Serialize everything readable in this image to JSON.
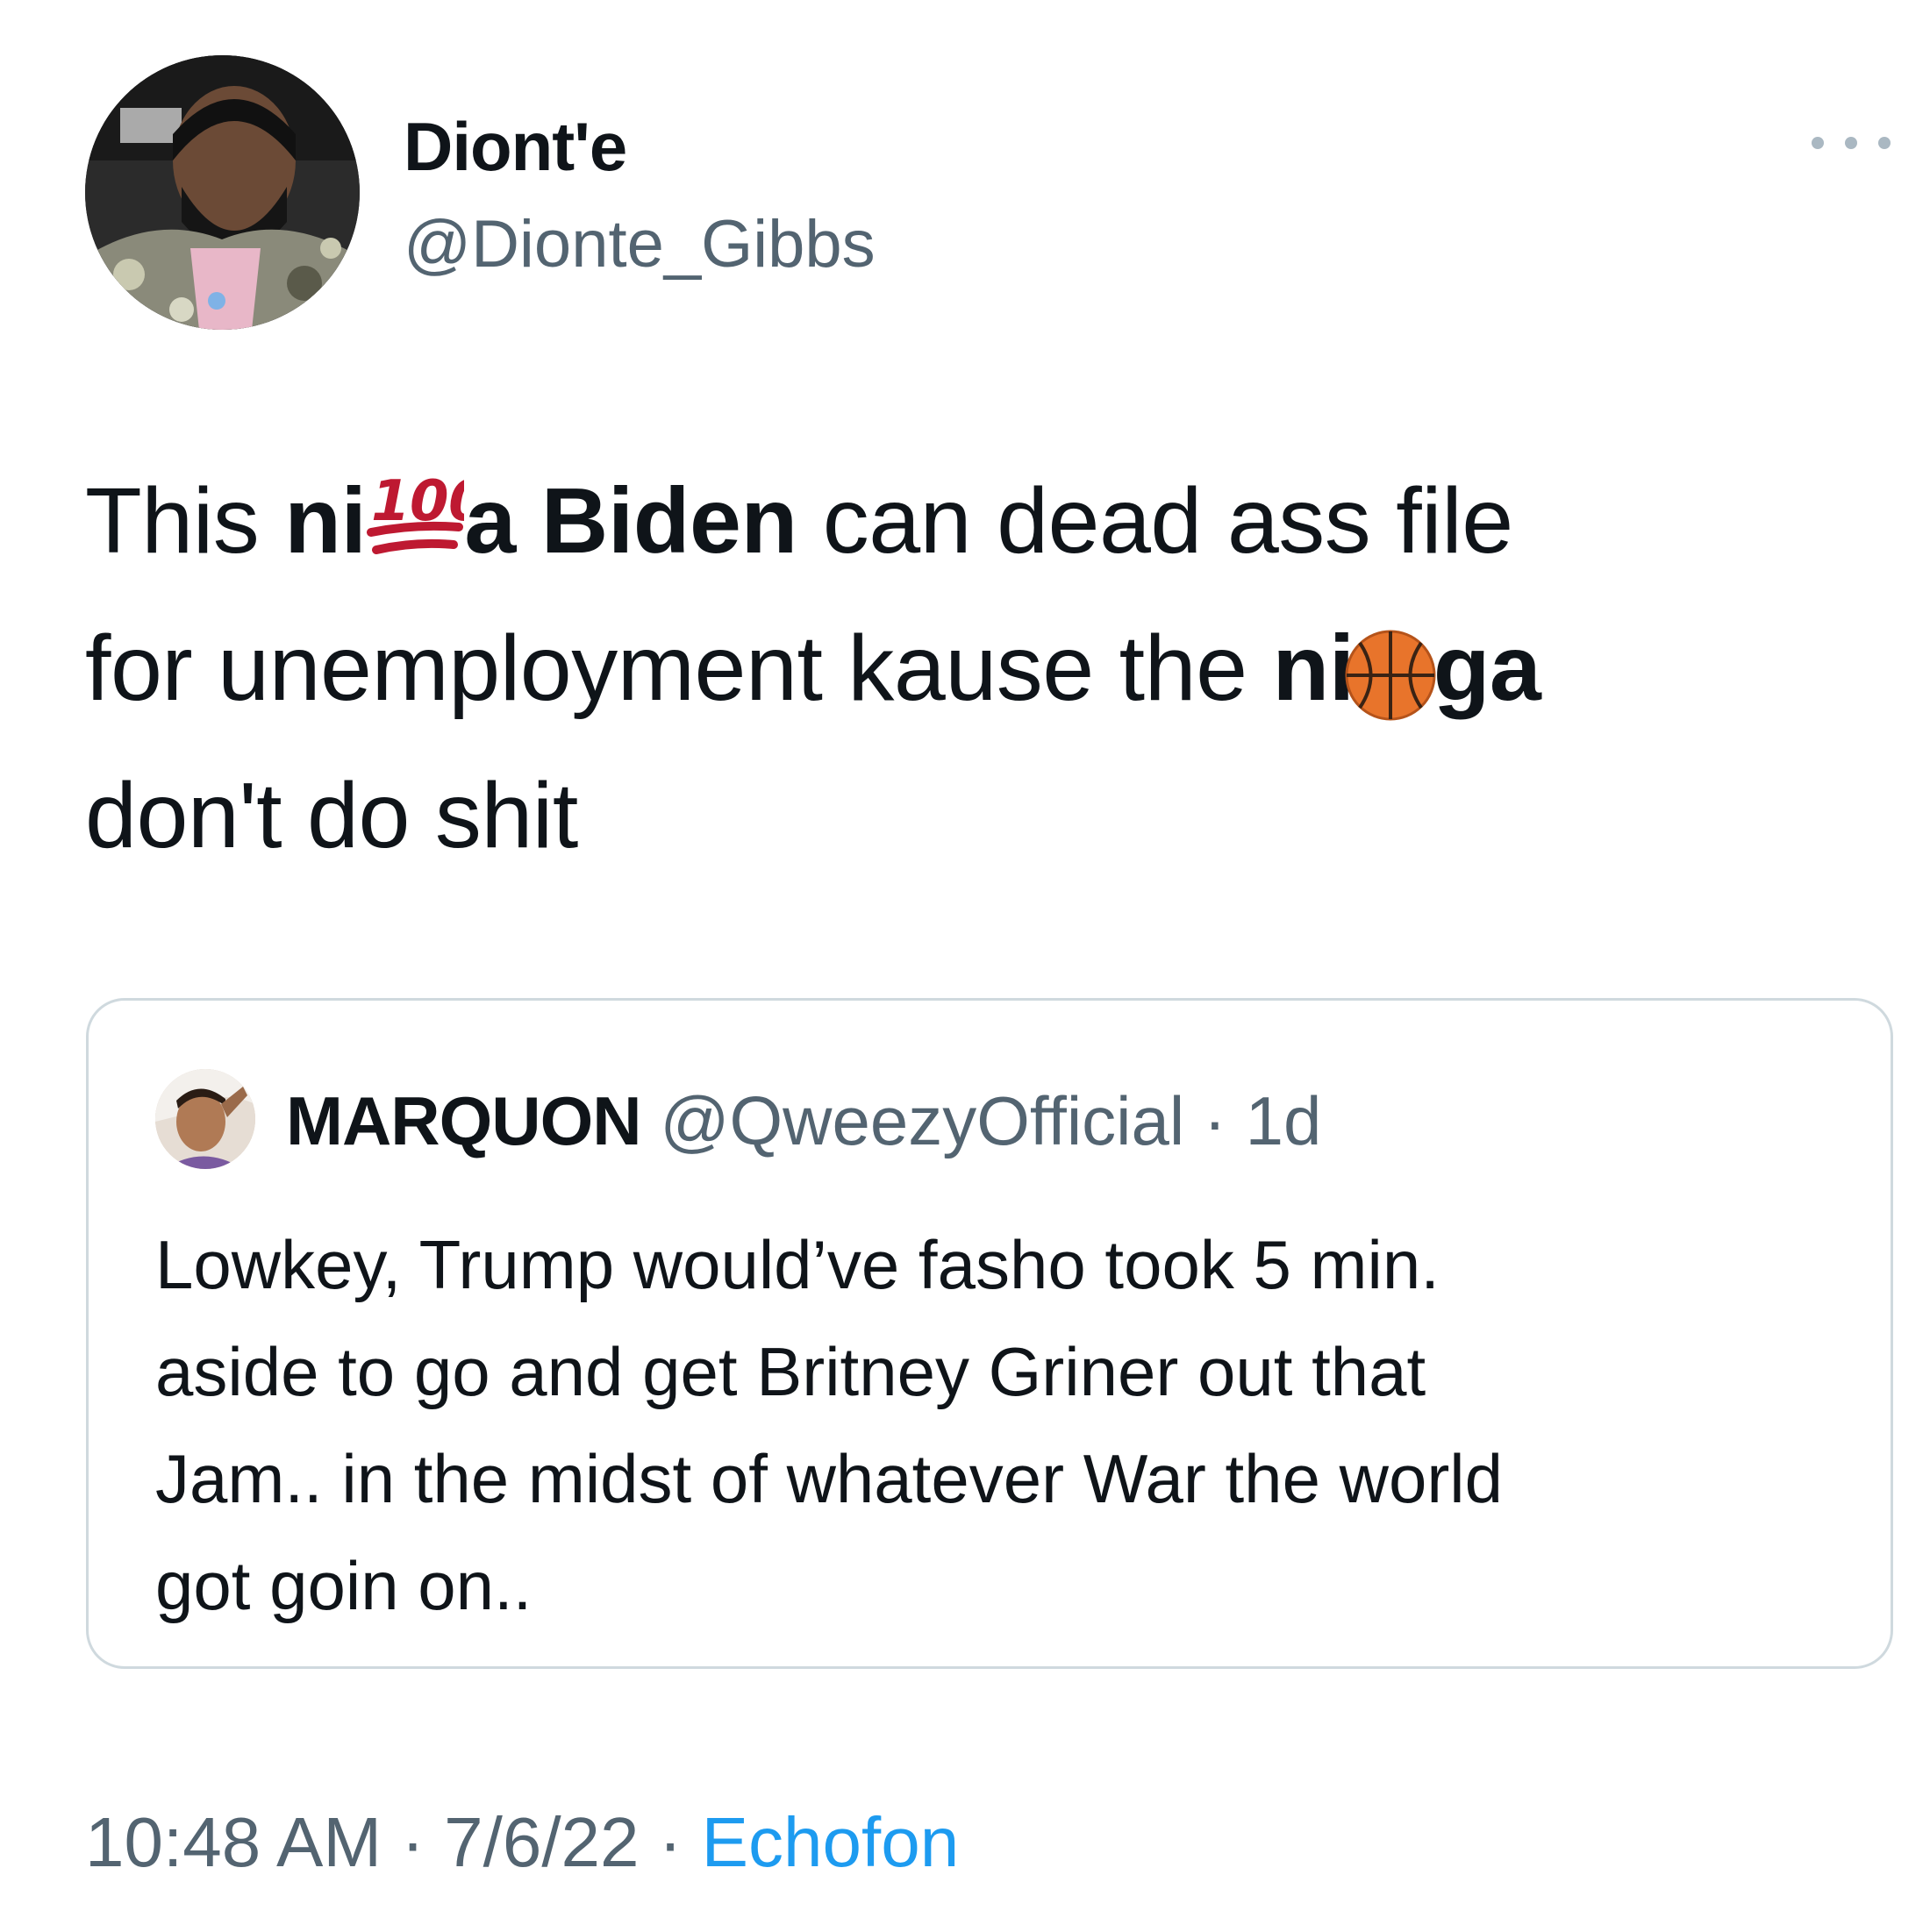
{
  "author": {
    "display_name": "Diont'e",
    "handle": "@Dionte_Gibbs",
    "avatar_icon": "profile-photo"
  },
  "tweet": {
    "lines": [
      [
        "This ",
        "ni",
        "a Biden",
        " can dead ass file"
      ],
      [
        "for unemployment kause the ",
        "ni",
        "ga"
      ],
      [
        "don't do shit"
      ]
    ],
    "emoji": [
      "100-emoji",
      "basketball-emoji"
    ]
  },
  "quoted": {
    "display_name": "MARQUON",
    "handle": "@QweezyOfficial",
    "separator": " · ",
    "time": "1d",
    "lines": [
      "Lowkey, Trump would’ve fasho took 5 min.",
      "aside to go and get Britney Griner out that",
      "Jam.. in the midst of whatever War the world",
      "got goin on.."
    ]
  },
  "meta": {
    "time": "10:48 AM",
    "sep1": " · ",
    "date": "7/6/22",
    "sep2": " · ",
    "source": "Echofon"
  },
  "colors": {
    "text": "#0f1419",
    "secondary": "#536471",
    "link": "#1d9bf0",
    "border": "#cfd9de"
  }
}
